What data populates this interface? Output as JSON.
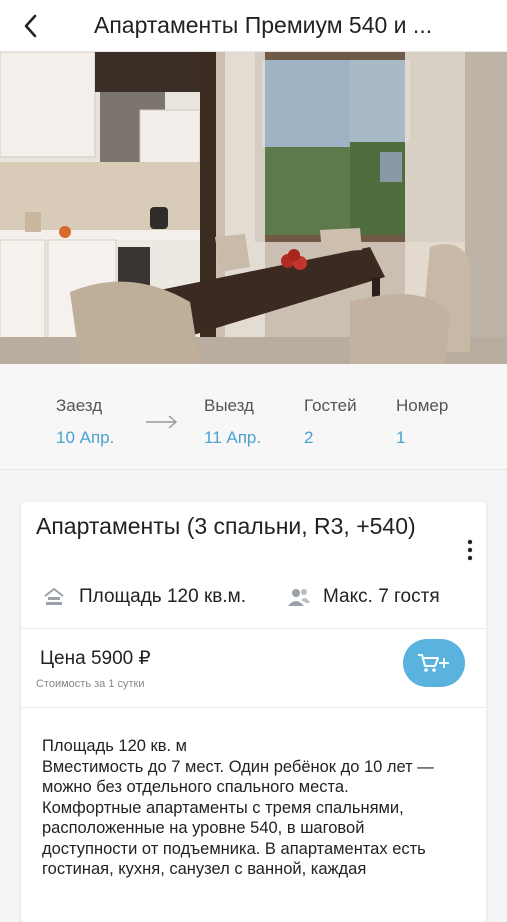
{
  "header": {
    "title": "Апартаменты Премиум 540 и ...",
    "back_icon": "chevron-left-icon"
  },
  "hero_image": {
    "subject": "apartment-interior"
  },
  "booking": {
    "checkin_label": "Заезд",
    "checkin_value": "10 Апр.",
    "checkout_label": "Выезд",
    "checkout_value": "11 Апр.",
    "guests_label": "Гостей",
    "guests_value": "2",
    "room_label": "Номер",
    "room_value": "1",
    "accent_color": "#4ba3cf"
  },
  "room": {
    "title": "Апартаменты (3 спальни, R3, +540)",
    "area_text": "Площадь 120 кв.м.",
    "max_guests_text": "Макс. 7 гостя",
    "price_text": "Цена 5900 ₽",
    "price_note": "Стоимость за 1 сутки",
    "cart_button_color": "#5ab3de",
    "description": "Площадь 120 кв. м\n Вместимость до 7 мест. Один ребёнок до 10 лет — можно без отдельного спального места.\nКомфортные апартаменты с тремя спальнями, расположенные на уровне 540, в шаговой доступности от подъемника. В апартаментах есть гостиная, кухня, санузел с ванной, каждая"
  }
}
